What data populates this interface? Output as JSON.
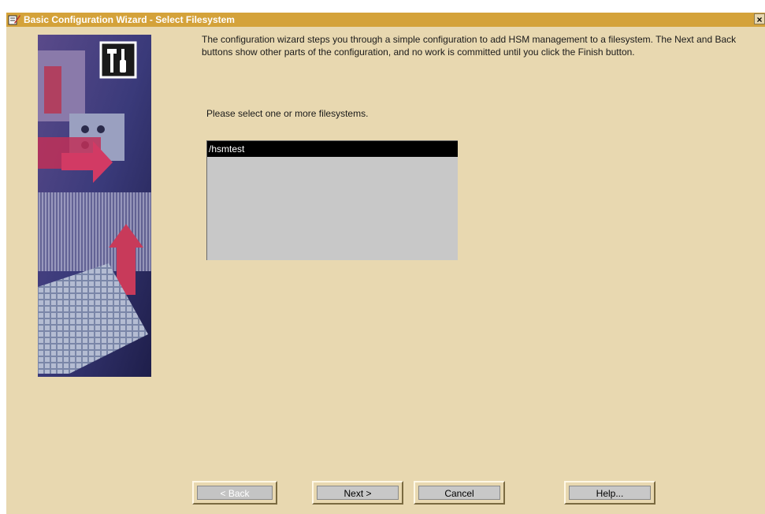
{
  "window": {
    "title": "Basic Configuration Wizard - Select Filesystem",
    "close_glyph": "×"
  },
  "intro_text": "The configuration wizard steps you through a simple configuration to add HSM management to a filesystem.  The Next and Back buttons show other parts of the configuration, and no work is committed until you click the Finish button.",
  "prompt_text": "Please select one or more filesystems.",
  "filesystems": [
    {
      "label": "/hsmtest",
      "selected": true
    }
  ],
  "buttons": {
    "back": "< Back",
    "next": "Next >",
    "cancel": "Cancel",
    "help": "Help..."
  },
  "colors": {
    "titlebar": "#d4a23a",
    "window_bg": "#e8d8b0",
    "list_bg": "#c8c8c8",
    "selection": "#000000"
  },
  "icons": {
    "app": "wizard-icon",
    "close": "close-icon",
    "wizard_art": "tools-icon"
  }
}
